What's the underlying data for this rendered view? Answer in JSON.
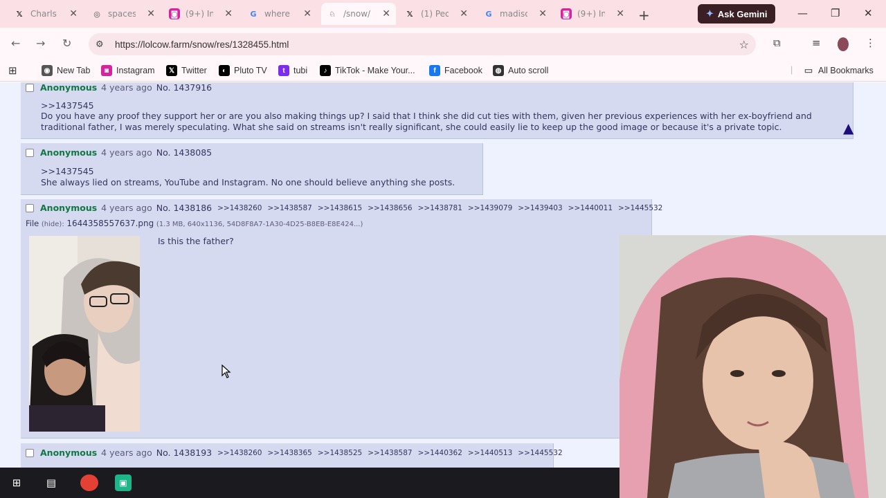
{
  "browser": {
    "tabs": [
      {
        "title": "Charls",
        "icon": "x-logo-icon"
      },
      {
        "title": "spaces",
        "icon": "page-icon"
      },
      {
        "title": "(9+) In",
        "icon": "instagram-icon"
      },
      {
        "title": "where",
        "icon": "google-icon"
      },
      {
        "title": "/snow/",
        "icon": "lolcow-icon",
        "active": true
      },
      {
        "title": "(1) Peo",
        "icon": "x-logo-icon"
      },
      {
        "title": "madiso",
        "icon": "google-icon"
      },
      {
        "title": "(9+) In",
        "icon": "instagram-icon"
      }
    ],
    "ask_gemini_label": "Ask Gemini",
    "url": "https://lolcow.farm/snow/res/1328455.html"
  },
  "bookmarks": {
    "items": [
      "New Tab",
      "Instagram",
      "Twitter",
      "Pluto TV",
      "tubi",
      "TikTok - Make Your...",
      "Facebook",
      "Auto scroll"
    ],
    "all_bookmarks": "All Bookmarks"
  },
  "posts": [
    {
      "name": "Anonymous",
      "time": "4 years ago",
      "no": "No. 1437916",
      "quote": ">>1437545",
      "text": "Do you have any proof they support her or are you also making things up? I said that I think she did cut ties with them, given her previous experiences with her ex-boyfriend and traditional father, I was merely speculating. What she said on streams isn't really significant, she could easily lie to keep up the good image or because it's a private topic."
    },
    {
      "name": "Anonymous",
      "time": "4 years ago",
      "no": "No. 1438085",
      "quote": ">>1437545",
      "text": "She always lied on streams, YouTube and Instagram. No one should believe anything she posts."
    },
    {
      "name": "Anonymous",
      "time": "4 years ago",
      "no": "No. 1438186",
      "backlinks": [
        ">>1438260",
        ">>1438587",
        ">>1438615",
        ">>1438656",
        ">>1438781",
        ">>1439079",
        ">>1439403",
        ">>1440011",
        ">>1445532"
      ],
      "file_label": "File",
      "file_hide": "(hide):",
      "file_name": "1644358557637.png",
      "file_meta": "(1.3 MB, 640x1136, 54D8F8A7-1A30-4D25-B8EB-E8E424...)",
      "text": "Is this the father?"
    },
    {
      "name": "Anonymous",
      "time": "4 years ago",
      "no": "No. 1438193",
      "backlinks": [
        ">>1438260",
        ">>1438365",
        ">>1438525",
        ">>1438587",
        ">>1440362",
        ">>1440513",
        ">>1445532"
      ]
    }
  ],
  "colors": {
    "post_bg": "#d6daf0",
    "name": "#117743",
    "page_bg": "#eef2ff",
    "tab_strip": "#fbe0e6"
  }
}
